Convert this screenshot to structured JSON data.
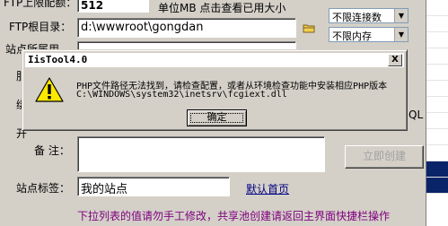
{
  "form": {
    "space_label": "FTP上限配额：",
    "space_value": "512",
    "space_hint": "单位MB 点击查看已用大小",
    "ftp_dir_label": "FTP根目录：",
    "ftp_dir_value": "d:\\wwwroot\\gongdan",
    "conn_select": "不限连接数",
    "mem_select": "不限内存",
    "site_user_label": "站点所属用",
    "remark_label": "备  注：",
    "remark_value": "",
    "create_button": "立即创建",
    "site_tag_label": "站点标签：",
    "site_tag_value": "我的站点",
    "default_home_link": "默认首页",
    "bottom_hint": "下拉列表的值请勿手工修改，共享池创建请返回主界面快捷栏操作",
    "partial_letters": [
      "服",
      "绑",
      "开"
    ],
    "partial_right": "QL"
  },
  "dialog": {
    "title": "IisTool4.0",
    "message_line1": "PHP文件路径无法找到，请检查配置，或者从环境检查功能中安装相应PHP版本",
    "message_line2": "C:\\WINDOWS\\system32\\inetsrv\\fcgiext.dll",
    "ok_label": "确定",
    "close_label": "X",
    "icon": "warning-icon"
  }
}
